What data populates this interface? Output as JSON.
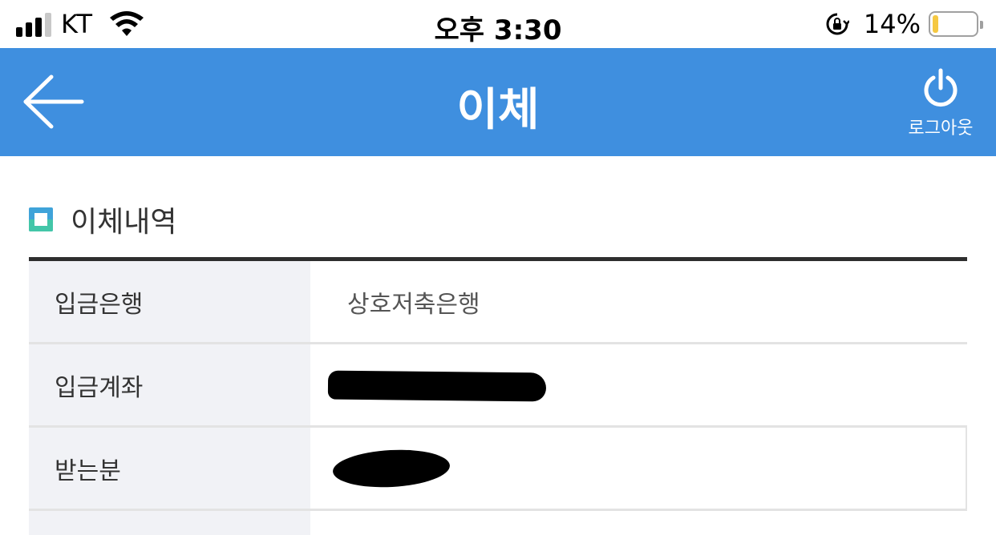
{
  "status_bar": {
    "carrier": "KT",
    "time": "오후 3:30",
    "battery_percent": "14%",
    "battery_level": 0.14,
    "signal_bars": 3,
    "icons": [
      "signal-icon",
      "wifi-icon",
      "rotation-lock-icon",
      "battery-icon"
    ]
  },
  "header": {
    "title": "이체",
    "back_icon": "arrow-left-icon",
    "logout_icon": "power-icon",
    "logout_label": "로그아웃",
    "background_color": "#3f8fdf"
  },
  "section": {
    "title": "이체내역",
    "icon": "square-bullet-icon"
  },
  "details": {
    "rows": [
      {
        "label": "입금은행",
        "value": "상호저축은행",
        "redacted": false
      },
      {
        "label": "입금계좌",
        "value": "",
        "redacted": true
      },
      {
        "label": "받는분",
        "value": "",
        "redacted": true
      }
    ]
  }
}
